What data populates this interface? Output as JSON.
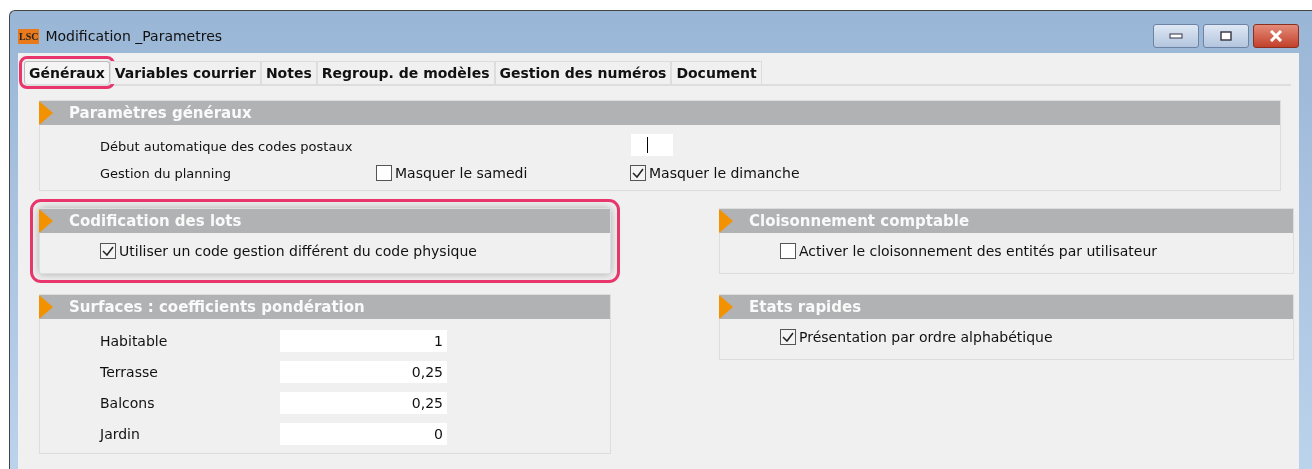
{
  "window": {
    "title": "Modification _Parametres",
    "logo": "LSC"
  },
  "tabs": [
    {
      "label": "Généraux",
      "selected": true,
      "highlighted": true
    },
    {
      "label": "Variables courrier",
      "selected": false,
      "highlighted": false
    },
    {
      "label": "Notes",
      "selected": false,
      "highlighted": false
    },
    {
      "label": "Regroup. de modèles",
      "selected": false,
      "highlighted": false
    },
    {
      "label": "Gestion des numéros",
      "selected": false,
      "highlighted": false
    },
    {
      "label": "Document",
      "selected": false,
      "highlighted": false
    }
  ],
  "general": {
    "title": "Paramètres généraux",
    "highlighted": false,
    "postal_label": "Début automatique des codes postaux",
    "planning_label": "Gestion du planning",
    "options": [
      {
        "label": "Masquer le samedi",
        "checked": false
      },
      {
        "label": "Masquer le dimanche",
        "checked": true
      }
    ]
  },
  "lots": {
    "title": "Codification des lots",
    "highlighted": true,
    "options": [
      {
        "label": "Utiliser un code gestion différent du code physique",
        "checked": true
      }
    ]
  },
  "cloisonnement": {
    "title": "Cloisonnement comptable",
    "highlighted": false,
    "options": [
      {
        "label": "Activer le cloisonnement des entités par utilisateur",
        "checked": false
      }
    ]
  },
  "surfaces": {
    "title": "Surfaces  : coefficients pondération",
    "highlighted": false,
    "rows": [
      {
        "label": "Habitable",
        "value": "1"
      },
      {
        "label": "Terrasse",
        "value": "0,25"
      },
      {
        "label": "Balcons",
        "value": "0,25"
      },
      {
        "label": "Jardin",
        "value": "0"
      }
    ]
  },
  "etats": {
    "title": "Etats rapides",
    "highlighted": false,
    "options": [
      {
        "label": "Présentation par ordre alphabétique",
        "checked": true
      }
    ]
  }
}
